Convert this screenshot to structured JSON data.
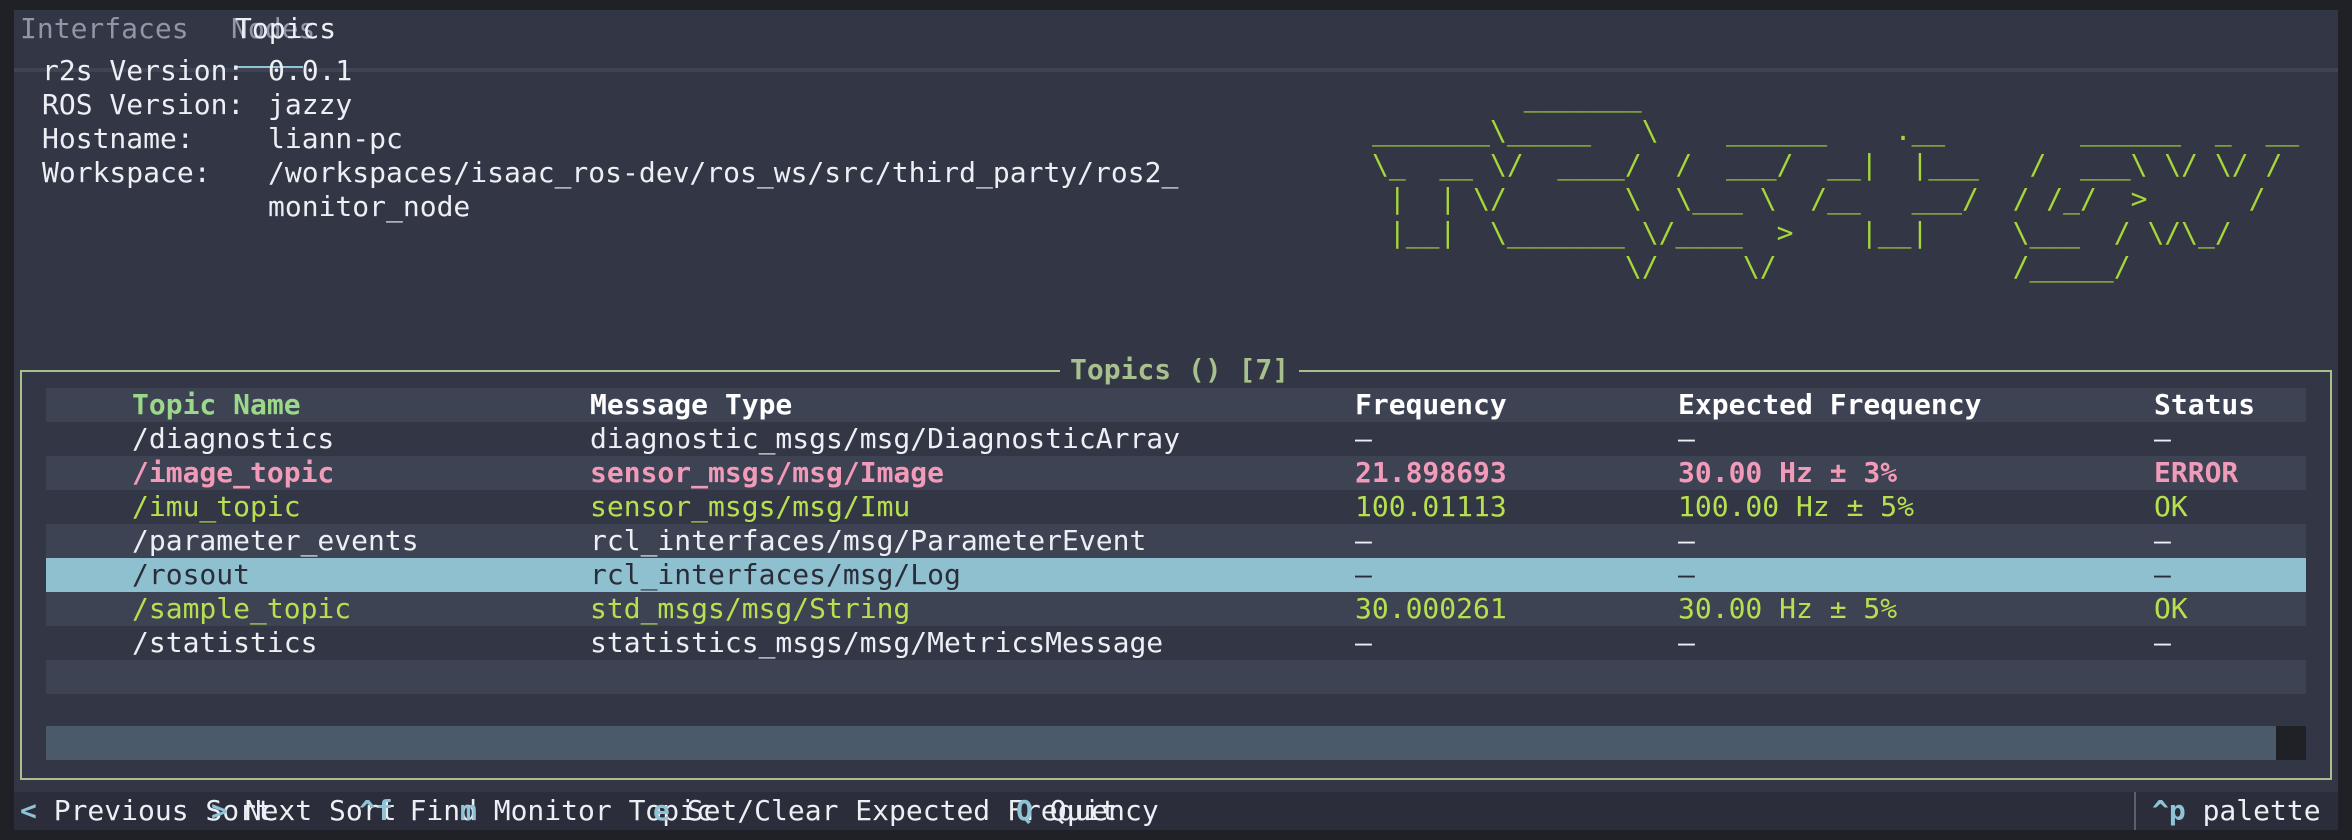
{
  "tabs": [
    {
      "label": "Interfaces"
    },
    {
      "label": "Nodes"
    },
    {
      "label": "Topics"
    }
  ],
  "info": {
    "r2s_version_label": "r2s Version:",
    "r2s_version": "0.0.1",
    "ros_version_label": "ROS Version:",
    "ros_version": "jazzy",
    "hostname_label": "Hostname:",
    "hostname": "liann-pc",
    "workspace_label": "Workspace:",
    "workspace_line1": "/workspaces/isaac_ros-dev/ros_ws/src/third_party/ros2_",
    "workspace_line2": "monitor_node"
  },
  "logo_ascii": "         _______\n_______\\_____   \\    ______    .__        ______  _  __\n\\_  __ \\/  ____/  /  ___/  __|  |___   /  ___\\ \\/ \\/ /\n |  | \\/       \\  \\___ \\  /__   ___/  / /_/  >      /\n |__|  \\_______ \\/____  >    |__|     \\___  / \\/\\_/\n               \\/     \\/              /_____/",
  "panel": {
    "title": "Topics () [7]"
  },
  "table": {
    "columns": [
      "Topic Name",
      "Message Type",
      "Frequency",
      "Expected Frequency",
      "Status"
    ],
    "rows": [
      {
        "name": "/diagnostics",
        "type": "diagnostic_msgs/msg/DiagnosticArray",
        "freq": "–",
        "expected": "–",
        "status": "–",
        "state": "normal"
      },
      {
        "name": "/image_topic",
        "type": "sensor_msgs/msg/Image",
        "freq": "21.898693",
        "expected": "30.00 Hz ± 3%",
        "status": "ERROR",
        "state": "error"
      },
      {
        "name": "/imu_topic",
        "type": "sensor_msgs/msg/Imu",
        "freq": "100.01113",
        "expected": "100.00 Hz ± 5%",
        "status": "OK",
        "state": "ok"
      },
      {
        "name": "/parameter_events",
        "type": "rcl_interfaces/msg/ParameterEvent",
        "freq": "–",
        "expected": "–",
        "status": "–",
        "state": "normal"
      },
      {
        "name": "/rosout",
        "type": "rcl_interfaces/msg/Log",
        "freq": "–",
        "expected": "–",
        "status": "–",
        "state": "selected"
      },
      {
        "name": "/sample_topic",
        "type": "std_msgs/msg/String",
        "freq": "30.000261",
        "expected": "30.00 Hz ± 5%",
        "status": "OK",
        "state": "ok"
      },
      {
        "name": "/statistics",
        "type": "statistics_msgs/msg/MetricsMessage",
        "freq": "–",
        "expected": "–",
        "status": "–",
        "state": "normal"
      }
    ]
  },
  "footer": {
    "keys": [
      {
        "key": "<",
        "desc": "Previous Sort"
      },
      {
        "key": ">",
        "desc": "Next Sort"
      },
      {
        "key": "^f",
        "desc": "Find"
      },
      {
        "key": "m",
        "desc": "Monitor Topic"
      },
      {
        "key": "e",
        "desc": "Set/Clear Expected Frequency"
      },
      {
        "key": "Q",
        "desc": "Quit"
      }
    ],
    "palette_key": "^p",
    "palette_desc": "palette"
  },
  "colors": {
    "background": "#323645",
    "accent": "#8fc3d6",
    "error": "#f29bb8",
    "ok": "#b7e050",
    "logo": "#a6d637",
    "panel_border": "#a7c08d"
  }
}
